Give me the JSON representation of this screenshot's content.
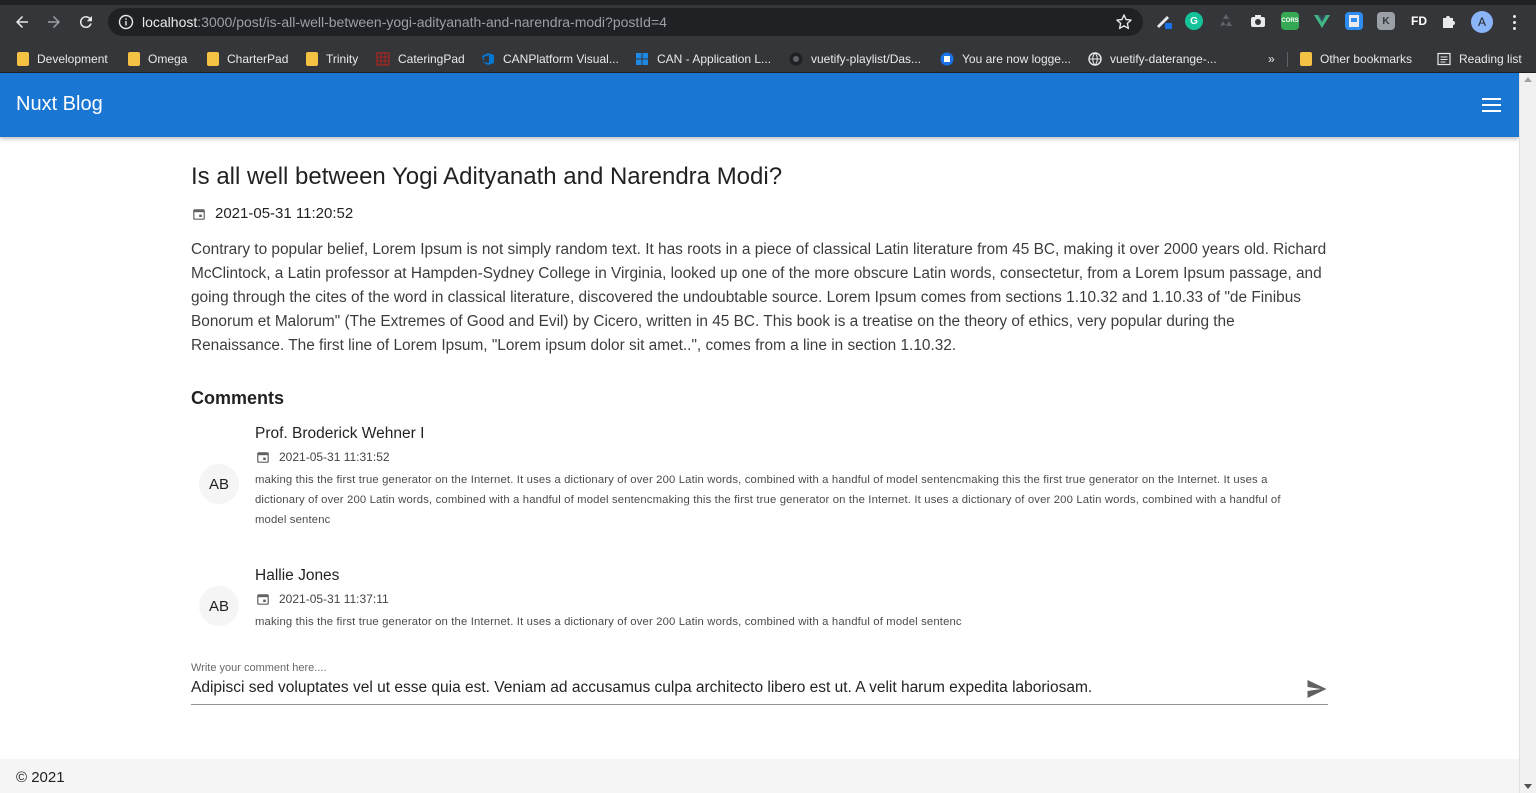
{
  "browser": {
    "url_host": "localhost",
    "url_path": ":3000/post/is-all-well-between-yogi-adityanath-and-narendra-modi?postId=4",
    "profile_initial": "A",
    "extensions": [
      "pen-extension",
      "grammarly",
      "recycle",
      "camera",
      "cors",
      "vue-devtools",
      "android",
      "kolibri",
      "FD",
      "puzzle"
    ],
    "fd_label": "FD",
    "cors_label": "CORS"
  },
  "bookmarks": {
    "items": [
      {
        "label": "Development",
        "icon": "folder-icon"
      },
      {
        "label": "Omega",
        "icon": "folder-icon"
      },
      {
        "label": "CharterPad",
        "icon": "folder-icon"
      },
      {
        "label": "Trinity",
        "icon": "folder-icon"
      },
      {
        "label": "CateringPad",
        "icon": "grid-icon"
      },
      {
        "label": "CANPlatform Visual...",
        "icon": "azure-devops-icon"
      },
      {
        "label": "CAN - Application L...",
        "icon": "windows-icon"
      },
      {
        "label": "vuetify-playlist/Das...",
        "icon": "github-icon"
      },
      {
        "label": "You are now logge...",
        "icon": "login-icon"
      },
      {
        "label": "vuetify-daterange-...",
        "icon": "globe-icon"
      }
    ],
    "overflow": "»",
    "other": "Other bookmarks",
    "reading_list": "Reading list"
  },
  "app": {
    "title": "Nuxt Blog",
    "primary_color": "#1976d2"
  },
  "post": {
    "title": "Is all well between Yogi Adityanath and Narendra Modi?",
    "date": "2021-05-31 11:20:52",
    "body": "Contrary to popular belief, Lorem Ipsum is not simply random text. It has roots in a piece of classical Latin literature from 45 BC, making it over 2000 years old. Richard McClintock, a Latin professor at Hampden-Sydney College in Virginia, looked up one of the more obscure Latin words, consectetur, from a Lorem Ipsum passage, and going through the cites of the word in classical literature, discovered the undoubtable source. Lorem Ipsum comes from sections 1.10.32 and 1.10.33 of \"de Finibus Bonorum et Malorum\" (The Extremes of Good and Evil) by Cicero, written in 45 BC. This book is a treatise on the theory of ethics, very popular during the Renaissance. The first line of Lorem Ipsum, \"Lorem ipsum dolor sit amet..\", comes from a line in section 1.10.32."
  },
  "comments": {
    "heading": "Comments",
    "items": [
      {
        "initials": "AB",
        "author": "Prof. Broderick Wehner I",
        "date": "2021-05-31 11:31:52",
        "text": "making this the first true generator on the Internet. It uses a dictionary of over 200 Latin words, combined with a handful of model sentencmaking this the first true generator on the Internet. It uses a dictionary of over 200 Latin words, combined with a handful of model sentencmaking this the first true generator on the Internet. It uses a dictionary of over 200 Latin words, combined with a handful of model sentenc"
      },
      {
        "initials": "AB",
        "author": "Hallie Jones",
        "date": "2021-05-31 11:37:11",
        "text": "making this the first true generator on the Internet. It uses a dictionary of over 200 Latin words, combined with a handful of model sentenc"
      }
    ]
  },
  "comment_form": {
    "label": "Write your comment here....",
    "value": "Adipisci sed voluptates vel ut esse quia est. Veniam ad accusamus culpa architecto libero est ut. A velit harum expedita laboriosam."
  },
  "footer": {
    "text": "© 2021"
  }
}
